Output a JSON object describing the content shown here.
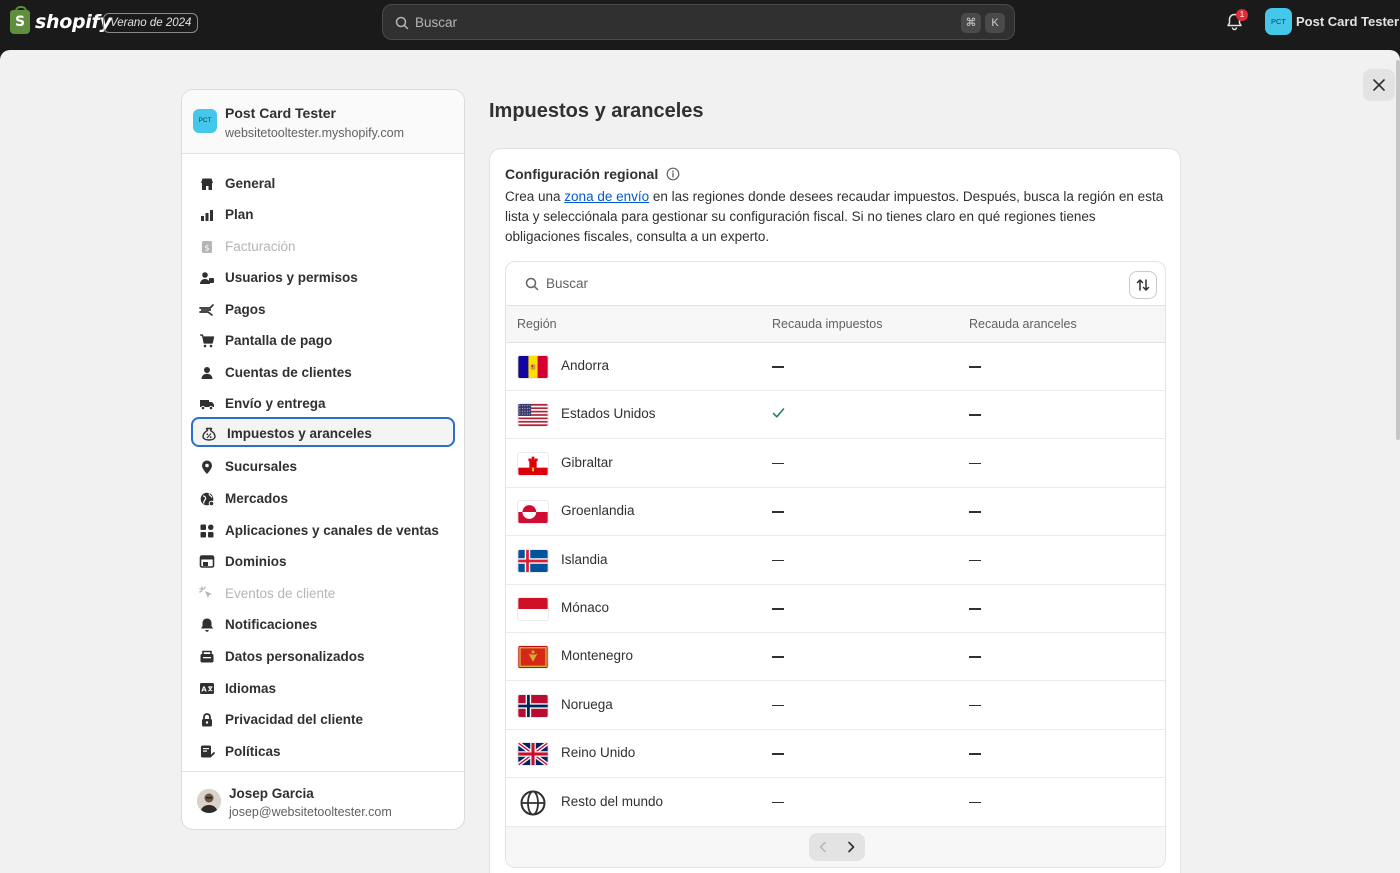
{
  "topbar": {
    "brand": "shopify",
    "logo_letter": "S",
    "edition": "Verano de 2024",
    "search_placeholder": "Buscar",
    "shortcut_cmd": "⌘",
    "shortcut_key": "K",
    "notifications_count": "1",
    "store_initials": "PCT",
    "store_name": "Post Card Tester"
  },
  "sidebar": {
    "store_initials": "PCT",
    "store_name": "Post Card Tester",
    "store_domain": "websitetooltester.myshopify.com",
    "items": [
      {
        "label": "General",
        "icon": "store-icon",
        "state": "normal"
      },
      {
        "label": "Plan",
        "icon": "plan-icon",
        "state": "normal"
      },
      {
        "label": "Facturación",
        "icon": "billing-icon",
        "state": "disabled"
      },
      {
        "label": "Usuarios y permisos",
        "icon": "users-icon",
        "state": "normal"
      },
      {
        "label": "Pagos",
        "icon": "payments-icon",
        "state": "normal"
      },
      {
        "label": "Pantalla de pago",
        "icon": "cart-icon",
        "state": "normal"
      },
      {
        "label": "Cuentas de clientes",
        "icon": "person-icon",
        "state": "normal"
      },
      {
        "label": "Envío y entrega",
        "icon": "truck-icon",
        "state": "normal"
      },
      {
        "label": "Impuestos y aranceles",
        "icon": "tax-icon",
        "state": "active"
      },
      {
        "label": "Sucursales",
        "icon": "location-icon",
        "state": "normal"
      },
      {
        "label": "Mercados",
        "icon": "globe-icon",
        "state": "normal"
      },
      {
        "label": "Aplicaciones y canales de ventas",
        "icon": "apps-icon",
        "state": "normal"
      },
      {
        "label": "Dominios",
        "icon": "domains-icon",
        "state": "normal"
      },
      {
        "label": "Eventos de cliente",
        "icon": "cursor-icon",
        "state": "disabled"
      },
      {
        "label": "Notificaciones",
        "icon": "bell-icon",
        "state": "normal"
      },
      {
        "label": "Datos personalizados",
        "icon": "data-icon",
        "state": "normal"
      },
      {
        "label": "Idiomas",
        "icon": "language-icon",
        "state": "normal"
      },
      {
        "label": "Privacidad del cliente",
        "icon": "lock-icon",
        "state": "normal"
      },
      {
        "label": "Políticas",
        "icon": "policy-icon",
        "state": "normal"
      }
    ],
    "user_name": "Josep Garcia",
    "user_email": "josep@websitetooltester.com"
  },
  "main": {
    "title": "Impuestos y aranceles",
    "card_title": "Configuración regional",
    "desc_before": "Crea una ",
    "desc_link": "zona de envío",
    "desc_after": " en las regiones donde desees recaudar impuestos. Después, busca la región en esta lista y selecciónala para gestionar su configuración fiscal. Si no tienes claro en qué regiones tienes obligaciones fiscales, consulta a un experto.",
    "table_search_placeholder": "Buscar",
    "columns": [
      "Región",
      "Recauda impuestos",
      "Recauda aranceles"
    ],
    "rows": [
      {
        "region": "Andorra",
        "flag": "andorra",
        "taxes": false,
        "duties": false
      },
      {
        "region": "Estados Unidos",
        "flag": "usa",
        "taxes": true,
        "duties": false
      },
      {
        "region": "Gibraltar",
        "flag": "gibraltar",
        "taxes": false,
        "duties": false
      },
      {
        "region": "Groenlandia",
        "flag": "greenland",
        "taxes": false,
        "duties": false
      },
      {
        "region": "Islandia",
        "flag": "iceland",
        "taxes": false,
        "duties": false
      },
      {
        "region": "Mónaco",
        "flag": "monaco",
        "taxes": false,
        "duties": false
      },
      {
        "region": "Montenegro",
        "flag": "montenegro",
        "taxes": false,
        "duties": false
      },
      {
        "region": "Noruega",
        "flag": "norway",
        "taxes": false,
        "duties": false
      },
      {
        "region": "Reino Unido",
        "flag": "uk",
        "taxes": false,
        "duties": false
      },
      {
        "region": "Resto del mundo",
        "flag": "globe",
        "taxes": false,
        "duties": false
      }
    ]
  },
  "colors": {
    "accent": "#2c6ecb",
    "link": "#005bd3",
    "check": "#29845a"
  }
}
